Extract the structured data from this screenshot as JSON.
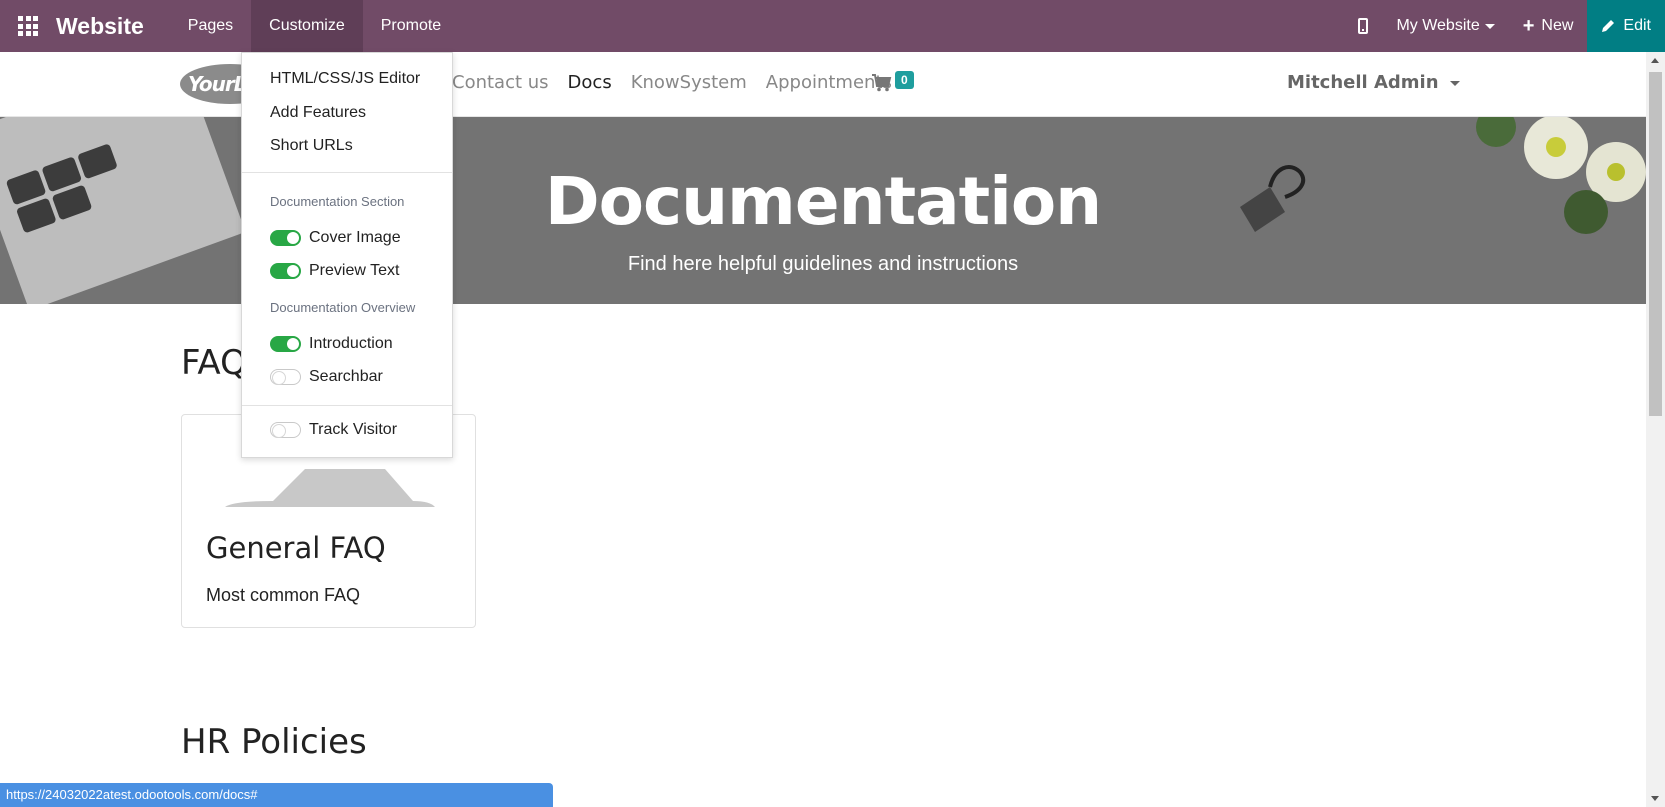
{
  "topbar": {
    "brand": "Website",
    "nav": [
      {
        "label": "Pages"
      },
      {
        "label": "Customize"
      },
      {
        "label": "Promote"
      }
    ],
    "site_selector": "My Website",
    "new_label": "New",
    "edit_label": "Edit",
    "colors": {
      "bar": "#714b67",
      "edit": "#017e84"
    }
  },
  "site_header": {
    "logo_text": "YourLogo",
    "nav": [
      {
        "label": "Contact us"
      },
      {
        "label": "Docs"
      },
      {
        "label": "KnowSystem"
      },
      {
        "label": "Appointments"
      }
    ],
    "cart_count": "0",
    "user": "Mitchell Admin"
  },
  "hero": {
    "title": "Documentation",
    "subtitle": "Find here helpful guidelines and instructions"
  },
  "content": {
    "sections": [
      {
        "title": "FAQ"
      },
      {
        "title": "HR Policies"
      }
    ],
    "card": {
      "title": "General FAQ",
      "description": "Most common FAQ"
    }
  },
  "customize_menu": {
    "items": [
      {
        "label": "HTML/CSS/JS Editor"
      },
      {
        "label": "Add Features"
      },
      {
        "label": "Short URLs"
      }
    ],
    "doc_section_header": "Documentation Section",
    "doc_section_toggles": [
      {
        "label": "Cover Image",
        "on": true
      },
      {
        "label": "Preview Text",
        "on": true
      }
    ],
    "doc_overview_header": "Documentation Overview",
    "doc_overview_toggles": [
      {
        "label": "Introduction",
        "on": true
      },
      {
        "label": "Searchbar",
        "on": false
      }
    ],
    "other_toggles": [
      {
        "label": "Track Visitor",
        "on": false
      }
    ],
    "toggle_on_color": "#28a745"
  },
  "status_url": "https://24032022atest.odootools.com/docs#"
}
